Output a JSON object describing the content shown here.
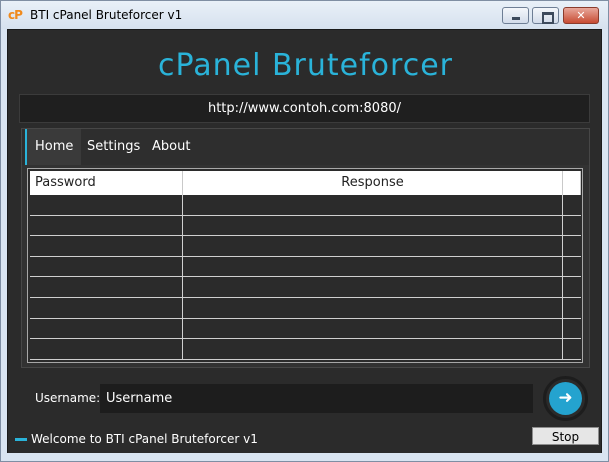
{
  "window": {
    "title": "BTI cPanel Bruteforcer v1",
    "icon": "cP",
    "close_glyph": "✕"
  },
  "header": {
    "app_title": "cPanel Bruteforcer",
    "url": "http://www.contoh.com:8080/"
  },
  "tabs": [
    {
      "label": "Home",
      "active": true
    },
    {
      "label": "Settings",
      "active": false
    },
    {
      "label": "About",
      "active": false
    }
  ],
  "grid": {
    "columns": [
      "Password",
      "Response"
    ],
    "rows": [
      [
        "",
        ""
      ],
      [
        "",
        ""
      ],
      [
        "",
        ""
      ],
      [
        "",
        ""
      ],
      [
        "",
        ""
      ],
      [
        "",
        ""
      ],
      [
        "",
        ""
      ],
      [
        "",
        ""
      ]
    ]
  },
  "form": {
    "username_label": "Username:",
    "username_value": "Username",
    "go_icon": "arrow-right-icon",
    "go_glyph": "➜"
  },
  "status": {
    "text": "Welcome to BTI cPanel Bruteforcer v1",
    "stop_label": "Stop"
  },
  "colors": {
    "accent": "#2ab3d9",
    "background": "#2b2b2b"
  }
}
